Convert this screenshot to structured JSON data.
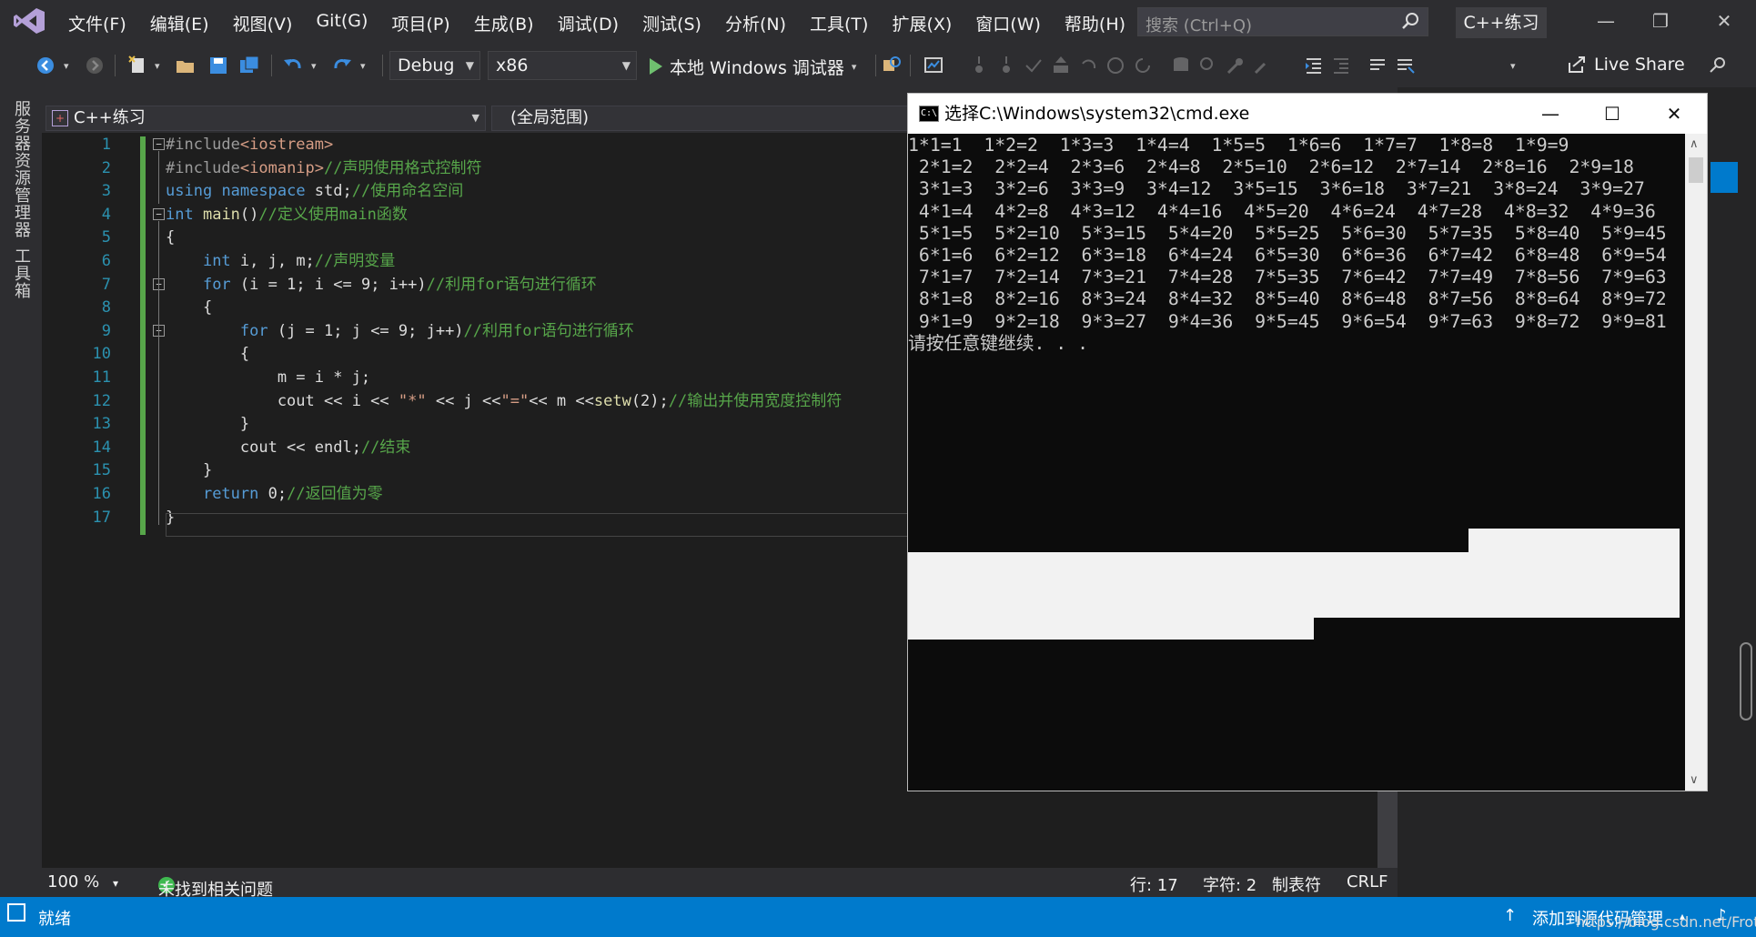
{
  "menu": {
    "items": [
      "文件(F)",
      "编辑(E)",
      "视图(V)",
      "Git(G)",
      "项目(P)",
      "生成(B)",
      "调试(D)",
      "测试(S)",
      "分析(N)",
      "工具(T)",
      "扩展(X)",
      "窗口(W)",
      "帮助(H)"
    ],
    "search_placeholder": "搜索 (Ctrl+Q)",
    "project_badge": "C++练习"
  },
  "toolbar": {
    "configuration": "Debug",
    "platform": "x86",
    "run_label": "本地 Windows 调试器",
    "live_share": "Live Share"
  },
  "side_tabs": {
    "server_explorer": "服务器资源管理器",
    "toolbox": "工具箱"
  },
  "editor": {
    "nav_project": "C++练习",
    "nav_scope": "(全局范围)",
    "zoom": "100 %",
    "problems": "未找到相关问题",
    "line_pos": "行: 17",
    "char_pos": "字符: 2",
    "tab_mode": "制表符",
    "eol": "CRLF",
    "lines": [
      {
        "n": "1",
        "parts": [
          [
            "pp",
            "#include"
          ],
          [
            "inc",
            "<iostream>"
          ]
        ]
      },
      {
        "n": "2",
        "parts": [
          [
            "pp",
            "#include"
          ],
          [
            "inc",
            "<iomanip>"
          ],
          [
            "cm",
            "//声明使用格式控制符"
          ]
        ]
      },
      {
        "n": "3",
        "parts": [
          [
            "kw",
            "using"
          ],
          [
            "plain",
            " "
          ],
          [
            "kw",
            "namespace"
          ],
          [
            "plain",
            " std;"
          ],
          [
            "cm",
            "//使用命名空间"
          ]
        ]
      },
      {
        "n": "4",
        "parts": [
          [
            "kw",
            "int"
          ],
          [
            "plain",
            " "
          ],
          [
            "fn",
            "main"
          ],
          [
            "plain",
            "()"
          ],
          [
            "cm",
            "//定义使用main函数"
          ]
        ]
      },
      {
        "n": "5",
        "parts": [
          [
            "plain",
            "{"
          ]
        ]
      },
      {
        "n": "6",
        "parts": [
          [
            "plain",
            "    "
          ],
          [
            "kw",
            "int"
          ],
          [
            "plain",
            " i, j, m;"
          ],
          [
            "cm",
            "//声明变量"
          ]
        ]
      },
      {
        "n": "7",
        "parts": [
          [
            "plain",
            "    "
          ],
          [
            "kw",
            "for"
          ],
          [
            "plain",
            " (i = 1; i <= 9; i++)"
          ],
          [
            "cm",
            "//利用for语句进行循环"
          ]
        ]
      },
      {
        "n": "8",
        "parts": [
          [
            "plain",
            "    {"
          ]
        ]
      },
      {
        "n": "9",
        "parts": [
          [
            "plain",
            "        "
          ],
          [
            "kw",
            "for"
          ],
          [
            "plain",
            " (j = 1; j <= 9; j++)"
          ],
          [
            "cm",
            "//利用for语句进行循环"
          ]
        ]
      },
      {
        "n": "10",
        "parts": [
          [
            "plain",
            "        {"
          ]
        ]
      },
      {
        "n": "11",
        "parts": [
          [
            "plain",
            "            m = i * j;"
          ]
        ]
      },
      {
        "n": "12",
        "parts": [
          [
            "plain",
            "            cout << i << "
          ],
          [
            "str",
            "\"*\""
          ],
          [
            "plain",
            " << j <<"
          ],
          [
            "str",
            "\"=\""
          ],
          [
            "plain",
            "<< m <<"
          ],
          [
            "fn",
            "setw"
          ],
          [
            "plain",
            "(2);"
          ],
          [
            "cm",
            "//输出并使用宽度控制符"
          ]
        ]
      },
      {
        "n": "13",
        "parts": [
          [
            "plain",
            "        }"
          ]
        ]
      },
      {
        "n": "14",
        "parts": [
          [
            "plain",
            "        cout << endl;"
          ],
          [
            "cm",
            "//结束"
          ]
        ]
      },
      {
        "n": "15",
        "parts": [
          [
            "plain",
            "    }"
          ]
        ]
      },
      {
        "n": "16",
        "parts": [
          [
            "plain",
            "    "
          ],
          [
            "kw",
            "return"
          ],
          [
            "plain",
            " 0;"
          ],
          [
            "cm",
            "//返回值为零"
          ]
        ]
      },
      {
        "n": "17",
        "parts": [
          [
            "plain",
            "}"
          ]
        ]
      }
    ]
  },
  "cmd": {
    "title": "选择C:\\Windows\\system32\\cmd.exe",
    "icon_text": "C:\\",
    "lines": [
      "1*1=1  1*2=2  1*3=3  1*4=4  1*5=5  1*6=6  1*7=7  1*8=8  1*9=9",
      " 2*1=2  2*2=4  2*3=6  2*4=8  2*5=10  2*6=12  2*7=14  2*8=16  2*9=18",
      " 3*1=3  3*2=6  3*3=9  3*4=12  3*5=15  3*6=18  3*7=21  3*8=24  3*9=27",
      " 4*1=4  4*2=8  4*3=12  4*4=16  4*5=20  4*6=24  4*7=28  4*8=32  4*9=36",
      " 5*1=5  5*2=10  5*3=15  5*4=20  5*5=25  5*6=30  5*7=35  5*8=40  5*9=45",
      " 6*1=6  6*2=12  6*3=18  6*4=24  6*5=30  6*6=36  6*7=42  6*8=48  6*9=54",
      " 7*1=7  7*2=14  7*3=21  7*4=28  7*5=35  7*6=42  7*7=49  7*8=56  7*9=63",
      " 8*1=8  8*2=16  8*3=24  8*4=32  8*5=40  8*6=48  8*7=56  8*8=64  8*9=72",
      " 9*1=9  9*2=18  9*3=27  9*4=36  9*5=45  9*6=54  9*7=63  9*8=72  9*9=81",
      "请按任意键继续. . ."
    ]
  },
  "status": {
    "ready": "就绪",
    "source_control": "添加到源代码管理",
    "watermark": "https://blog.csdn.net/Frotinx"
  }
}
